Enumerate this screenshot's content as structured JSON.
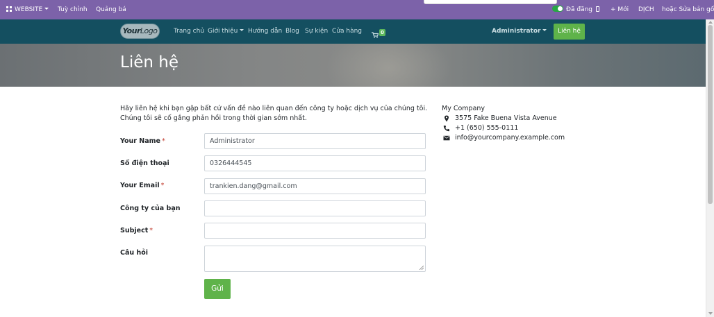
{
  "admin_bar": {
    "website_label": "WEBSITE",
    "customize_label": "Tuỳ chỉnh",
    "promote_label": "Quảng bá",
    "published_label": "Đã đăng",
    "new_label": "+ Mới",
    "translate_label": "DỊCH",
    "edit_label": "hoặc Sửa bản gốc"
  },
  "navbar": {
    "logo_your": "Your",
    "logo_logo": "Logo",
    "links": [
      "Trang chủ",
      "Giới thiệu",
      "Hướng dẫn",
      "Blog",
      "Sự kiện",
      "Cửa hàng"
    ],
    "cart_count": "0",
    "user_menu": "Administrator",
    "contact_button": "Liên hệ"
  },
  "page": {
    "title": "Liên hệ",
    "intro_line1": "Hãy liên hệ khi bạn gặp bất cứ vấn đề nào liên quan đến công ty hoặc dịch vụ của chúng tôi.",
    "intro_line2": "Chúng tôi sẽ cố gắng phản hồi trong thời gian sớm nhất."
  },
  "form": {
    "name_label": "Your Name",
    "name_value": "Administrator",
    "phone_label": "Số điện thoại",
    "phone_value": "0326444545",
    "email_label": "Your Email",
    "email_value": "trankien.dang@gmail.com",
    "company_label": "Công ty của bạn",
    "company_value": "",
    "subject_label": "Subject",
    "subject_value": "",
    "question_label": "Câu hỏi",
    "required_mark": "*",
    "submit_label": "Gửi"
  },
  "company": {
    "name": "My Company",
    "address": "3575 Fake Buena Vista Avenue",
    "phone": "+1 (650) 555-0111",
    "email": "info@yourcompany.example.com"
  },
  "colors": {
    "admin_bar": "#7c62a9",
    "navbar": "#144f60",
    "accent_button": "#5fb34a"
  }
}
